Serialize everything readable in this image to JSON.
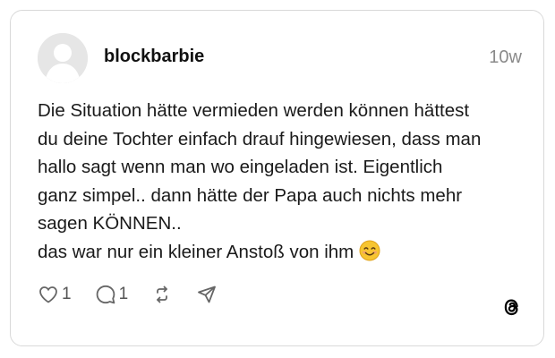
{
  "post": {
    "username": "blockbarbie",
    "timestamp": "10w",
    "text_lines": [
      "Die Situation hätte vermieden werden können hättest",
      "du deine Tochter einfach drauf hingewiesen, dass man",
      "hallo sagt wenn man wo eingeladen ist. Eigentlich",
      "ganz simpel.. dann hätte der Papa auch nichts mehr",
      "sagen KÖNNEN..",
      "das war nur ein kleiner Anstoß von ihm"
    ],
    "emoji": "😊"
  },
  "actions": {
    "like": {
      "icon": "heart-icon",
      "count": "1"
    },
    "reply": {
      "icon": "comment-icon",
      "count": "1"
    },
    "repost": {
      "icon": "repost-icon"
    },
    "share": {
      "icon": "send-icon"
    }
  },
  "brand": {
    "icon": "threads-logo",
    "color": "#000000"
  },
  "colors": {
    "border": "#d9d9d9",
    "muted": "#8a8a8a",
    "icon": "#666666",
    "text": "#1a1a1a"
  }
}
